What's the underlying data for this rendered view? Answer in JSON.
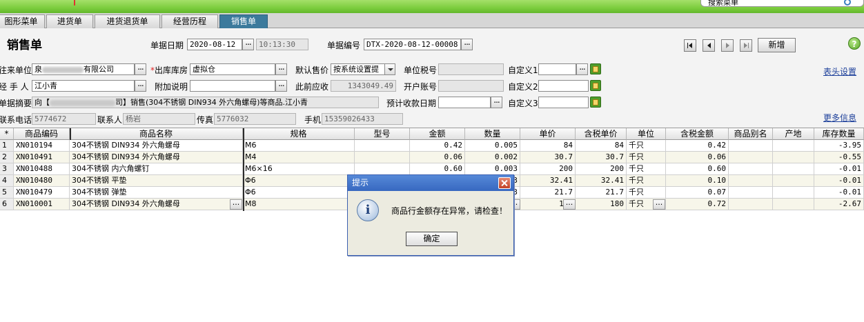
{
  "topbar": {
    "search_placeholder": "搜索菜单"
  },
  "tabs": [
    {
      "label": "图形菜单"
    },
    {
      "label": "进货单"
    },
    {
      "label": "进货退货单"
    },
    {
      "label": "经营历程"
    },
    {
      "label": "销售单"
    }
  ],
  "page_title": "销售单",
  "header": {
    "bill_date_label": "单据日期",
    "bill_date": "2020-08-12",
    "bill_time": "10:13:30",
    "bill_no_label": "单据编号",
    "bill_no": "DTX-2020-08-12-00008",
    "new_button": "新增",
    "help": "?"
  },
  "form": {
    "partner_label": "往来单位",
    "partner_value": "泉",
    "partner_suffix": "有限公司",
    "warehouse_label": "出库库房",
    "warehouse_value": "虚拟仓",
    "default_price_label": "默认售价",
    "default_price_value": "按系统设置提",
    "tax_no_label": "单位税号",
    "tax_no_value": "",
    "custom1_label": "自定义1",
    "custom1_value": "",
    "header_settings_link": "表头设置",
    "handler_label": "经 手 人",
    "handler_value": "江小青",
    "note_label": "附加说明",
    "note_value": "",
    "prev_receivable_label": "此前应收",
    "prev_receivable_value": "1343049.49",
    "bank_label": "开户账号",
    "bank_value": "",
    "custom2_label": "自定义2",
    "custom2_value": "",
    "summary_label": "单据摘要",
    "summary_prefix": "向【",
    "summary_suffix": "司】销售(304不锈钢 DIN934 外六角螺母)等商品.江小青",
    "due_date_label": "预计收款日期",
    "due_date_value": "",
    "custom3_label": "自定义3",
    "custom3_value": "",
    "phone_label": "联系电话",
    "phone_value": "5774672",
    "contact_label": "联系人",
    "contact_value": "杨岩",
    "fax_label": "传真",
    "fax_value": "5776032",
    "mobile_label": "手机",
    "mobile_value": "15359026433",
    "more_info_link": "更多信息"
  },
  "grid": {
    "corner": "*",
    "columns": [
      "商品编码",
      "商品名称",
      "规格",
      "型号",
      "金额",
      "数量",
      "单价",
      "含税单价",
      "单位",
      "含税金额",
      "商品别名",
      "产地",
      "库存数量"
    ],
    "rows": [
      {
        "idx": "1",
        "code": "XN010194",
        "name": "304不锈钢 DIN934 外六角螺母",
        "spec": "M6",
        "model": "",
        "amount": "0.42",
        "qty": "0.005",
        "price": "84",
        "tax_price": "84",
        "unit": "千只",
        "tax_amount": "0.42",
        "alias": "",
        "origin": "",
        "stock": "-3.95"
      },
      {
        "idx": "2",
        "code": "XN010491",
        "name": "304不锈钢 DIN934 外六角螺母",
        "spec": "M4",
        "model": "",
        "amount": "0.06",
        "qty": "0.002",
        "price": "30.7",
        "tax_price": "30.7",
        "unit": "千只",
        "tax_amount": "0.06",
        "alias": "",
        "origin": "",
        "stock": "-0.55"
      },
      {
        "idx": "3",
        "code": "XN010488",
        "name": "304不锈钢 内六角螺钉",
        "spec": "M6×16",
        "model": "",
        "amount": "0.60",
        "qty": "0.003",
        "price": "200",
        "tax_price": "200",
        "unit": "千只",
        "tax_amount": "0.60",
        "alias": "",
        "origin": "",
        "stock": "-0.01"
      },
      {
        "idx": "4",
        "code": "XN010480",
        "name": "304不锈钢 平垫",
        "spec": "Φ6",
        "model": "",
        "amount": "",
        "qty": "3",
        "price": "32.41",
        "tax_price": "32.41",
        "unit": "千只",
        "tax_amount": "0.10",
        "alias": "",
        "origin": "",
        "stock": "-0.01"
      },
      {
        "idx": "5",
        "code": "XN010479",
        "name": "304不锈钢 弹垫",
        "spec": "Φ6",
        "model": "",
        "amount": "",
        "qty": "3",
        "price": "21.7",
        "tax_price": "21.7",
        "unit": "千只",
        "tax_amount": "0.07",
        "alias": "",
        "origin": "",
        "stock": "-0.01"
      },
      {
        "idx": "6",
        "code": "XN010001",
        "name": "304不锈钢 DIN934 外六角螺母",
        "spec": "M8",
        "model": "",
        "amount": "",
        "qty": "",
        "price": "180",
        "tax_price": "180",
        "unit": "千只",
        "tax_amount": "0.72",
        "alias": "",
        "origin": "",
        "stock": "-2.67"
      }
    ]
  },
  "dialog": {
    "title": "提示",
    "message": "商品行金额存在异常，请检查！",
    "ok_button": "确定"
  }
}
